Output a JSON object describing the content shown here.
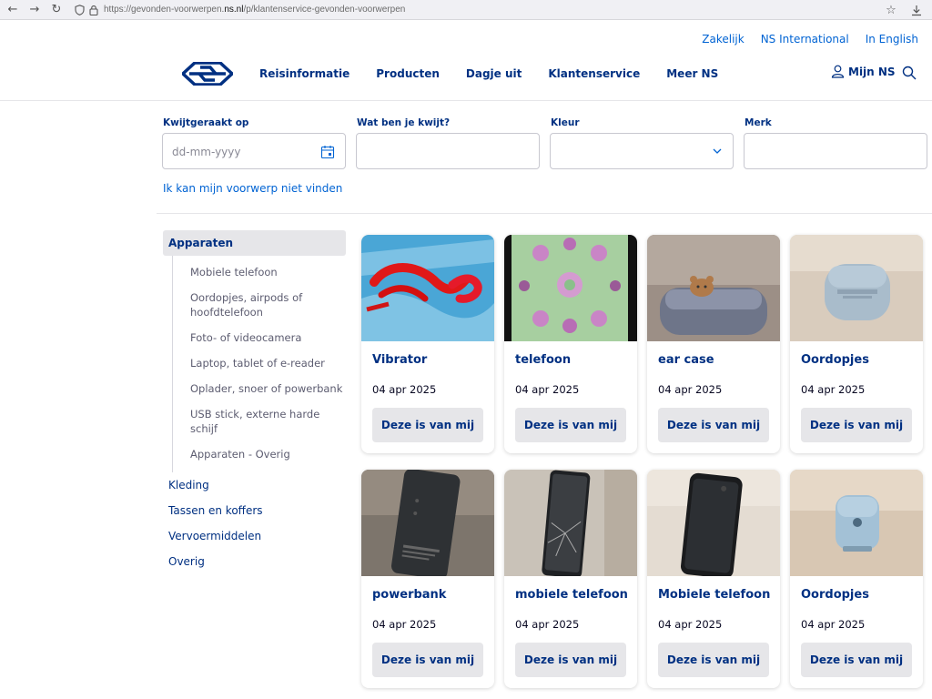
{
  "browser": {
    "url_prefix": "https://gevonden-voorwerpen.",
    "url_domain": "ns.nl",
    "url_path": "/p/klantenservice-gevonden-voorwerpen"
  },
  "header": {
    "util_links": [
      "Zakelijk",
      "NS International",
      "In English"
    ],
    "nav": [
      "Reisinformatie",
      "Producten",
      "Dagje uit",
      "Klantenservice",
      "Meer NS"
    ],
    "account_label": "Mijn NS"
  },
  "filters": {
    "date_label": "Kwijtgeraakt op",
    "date_placeholder": "dd-mm-yyyy",
    "what_label": "Wat ben je kwijt?",
    "color_label": "Kleur",
    "brand_label": "Merk",
    "not_found_link": "Ik kan mijn voorwerp niet vinden"
  },
  "sidebar": {
    "active": "Apparaten",
    "subcategories": [
      "Mobiele telefoon",
      "Oordopjes, airpods of hoofdtelefoon",
      "Foto- of videocamera",
      "Laptop, tablet of e-reader",
      "Oplader, snoer of powerbank",
      "USB stick, externe harde schijf",
      "Apparaten - Overig"
    ],
    "categories": [
      "Kleding",
      "Tassen en koffers",
      "Vervoermiddelen",
      "Overig"
    ]
  },
  "items": [
    {
      "title": "Vibrator",
      "date": "04 apr 2025",
      "button": "Deze is van mij",
      "image": "red-device-photo"
    },
    {
      "title": "telefoon",
      "date": "04 apr 2025",
      "button": "Deze is van mij",
      "image": "kaleidoscope-phone-photo"
    },
    {
      "title": "ear case",
      "date": "04 apr 2025",
      "button": "Deze is van mij",
      "image": "ear-case-photo"
    },
    {
      "title": "Oordopjes",
      "date": "04 apr 2025",
      "button": "Deze is van mij",
      "image": "samsung-buds-photo"
    },
    {
      "title": "powerbank",
      "date": "04 apr 2025",
      "button": "Deze is van mij",
      "image": "powerbank-photo"
    },
    {
      "title": "mobiele telefoon",
      "date": "04 apr 2025",
      "button": "Deze is van mij",
      "image": "cracked-phone-photo"
    },
    {
      "title": "Mobiele telefoon",
      "date": "04 apr 2025",
      "button": "Deze is van mij",
      "image": "black-phone-photo"
    },
    {
      "title": "Oordopjes",
      "date": "04 apr 2025",
      "button": "Deze is van mij",
      "image": "blue-buds-photo"
    }
  ],
  "colors": {
    "ns_blue": "#003082",
    "link_blue": "#0063d3",
    "button_grey": "#e6e6e9"
  }
}
